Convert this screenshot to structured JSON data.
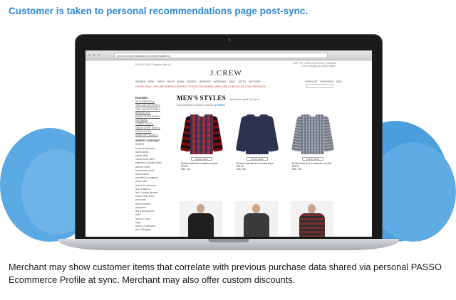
{
  "headline": "Customer is taken to personal recommendations page post-sync.",
  "bottom_text": "Merchant may show customer items that correlate with previous purchase data shared via personal PASSO Ecommerce Profile at sync. Merchant may also offer custom discounts.",
  "colors": {
    "headline": "#2e86d6",
    "cloud": "#4a9fde",
    "bezel": "#1a1a1a"
  },
  "browser": {
    "url": "jcrew.com/personalized-recommendations",
    "window_icons": "● ● ●"
  },
  "site": {
    "top_left": "MY ACCOUNT   Register   Sign In",
    "top_right_line1": "SHIP TO: UNITED STATES | CHANGE",
    "top_right_line2": "Free shipping on orders $150+",
    "logo": "J.CREW",
    "nav": "WOMEN   MEN   GIRLS   BOYS   BABY   SHOES   JEWELRY   WEDDING   SALE   GIFTS   FACTORY",
    "nav_right": "WISHLIST    SHOPPING BAG",
    "promo": "ONLINE ONLY • 30% OFF PRESENT-PERFECT STYLES FOR WOMEN, MEN, GIRLS & BOYS  USE CODE PRESENTS"
  },
  "sidebar": {
    "features_heading": "FEATURES",
    "features": [
      "NEW ARRIVALS ▸",
      "THE LUDLOW SHOP ▸",
      "THE LIQUOR STORE ▸",
      "BROKEN-IN ▸",
      "SWEAT SHIRT SHOP ▸",
      "OUTSIDE ▸",
      "T-SHIRT SHOP ▸",
      "SWEAT SHIRT SHOP ▸",
      "HIGHLIGHTS ▸",
      "GEAR GIFT GUIDE ▸"
    ],
    "category_heading": "SHOP BY CATEGORY",
    "category_sub": "SHIRTS",
    "categories": [
      "brushed twill shirts",
      "flannel shirts",
      "oxford shirts",
      "oxford dress shirts",
      "patterned & printed shirts",
      "washed shirts",
      "secret wash shirts",
      "tuxedo shirts",
      "sweaters & cardigans",
      "dress shirts",
      "jackets & outerwear",
      "suits & blazers",
      "ties & pocket squares",
      "cotton dress shirts",
      "polo shirts",
      "tees & henleys",
      "sleepwear",
      "ties & accessories",
      "belts",
      "shoes & boots",
      "bags",
      "socks & underwear",
      "teen & fit guide"
    ]
  },
  "main": {
    "title": "MEN'S STYLES",
    "subtitle": "selected just for you",
    "recommended_by": "Recommended products powered by",
    "passo": "PASSO",
    "quick_shop": "QUICK SHOP",
    "products": [
      {
        "name": "Brushed twill shirt in heathered plaid",
        "price": "$79.50",
        "sizes": "Slim, Tall"
      },
      {
        "name": "Brushed twill shirt in horizontal stripe",
        "price": "$79.50",
        "sizes": "Slim, Tall"
      },
      {
        "name": "Brushed twill shirt in authentic red plaid",
        "price": "$79.50",
        "sizes": "Slim, Tall"
      }
    ]
  }
}
